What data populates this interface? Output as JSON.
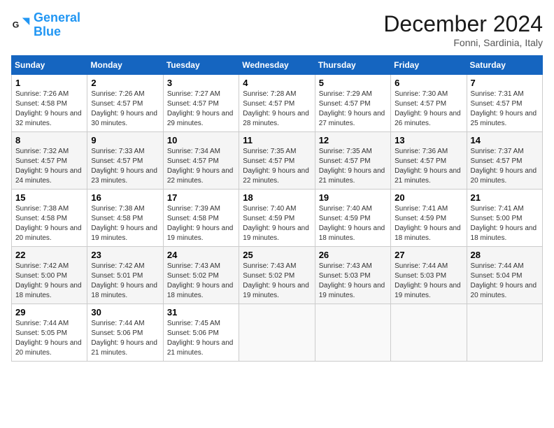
{
  "header": {
    "logo_line1": "General",
    "logo_line2": "Blue",
    "month_title": "December 2024",
    "location": "Fonni, Sardinia, Italy"
  },
  "weekdays": [
    "Sunday",
    "Monday",
    "Tuesday",
    "Wednesday",
    "Thursday",
    "Friday",
    "Saturday"
  ],
  "weeks": [
    [
      {
        "day": "1",
        "sunrise": "7:26 AM",
        "sunset": "4:58 PM",
        "daylight": "9 hours and 32 minutes."
      },
      {
        "day": "2",
        "sunrise": "7:26 AM",
        "sunset": "4:57 PM",
        "daylight": "9 hours and 30 minutes."
      },
      {
        "day": "3",
        "sunrise": "7:27 AM",
        "sunset": "4:57 PM",
        "daylight": "9 hours and 29 minutes."
      },
      {
        "day": "4",
        "sunrise": "7:28 AM",
        "sunset": "4:57 PM",
        "daylight": "9 hours and 28 minutes."
      },
      {
        "day": "5",
        "sunrise": "7:29 AM",
        "sunset": "4:57 PM",
        "daylight": "9 hours and 27 minutes."
      },
      {
        "day": "6",
        "sunrise": "7:30 AM",
        "sunset": "4:57 PM",
        "daylight": "9 hours and 26 minutes."
      },
      {
        "day": "7",
        "sunrise": "7:31 AM",
        "sunset": "4:57 PM",
        "daylight": "9 hours and 25 minutes."
      }
    ],
    [
      {
        "day": "8",
        "sunrise": "7:32 AM",
        "sunset": "4:57 PM",
        "daylight": "9 hours and 24 minutes."
      },
      {
        "day": "9",
        "sunrise": "7:33 AM",
        "sunset": "4:57 PM",
        "daylight": "9 hours and 23 minutes."
      },
      {
        "day": "10",
        "sunrise": "7:34 AM",
        "sunset": "4:57 PM",
        "daylight": "9 hours and 22 minutes."
      },
      {
        "day": "11",
        "sunrise": "7:35 AM",
        "sunset": "4:57 PM",
        "daylight": "9 hours and 22 minutes."
      },
      {
        "day": "12",
        "sunrise": "7:35 AM",
        "sunset": "4:57 PM",
        "daylight": "9 hours and 21 minutes."
      },
      {
        "day": "13",
        "sunrise": "7:36 AM",
        "sunset": "4:57 PM",
        "daylight": "9 hours and 21 minutes."
      },
      {
        "day": "14",
        "sunrise": "7:37 AM",
        "sunset": "4:57 PM",
        "daylight": "9 hours and 20 minutes."
      }
    ],
    [
      {
        "day": "15",
        "sunrise": "7:38 AM",
        "sunset": "4:58 PM",
        "daylight": "9 hours and 20 minutes."
      },
      {
        "day": "16",
        "sunrise": "7:38 AM",
        "sunset": "4:58 PM",
        "daylight": "9 hours and 19 minutes."
      },
      {
        "day": "17",
        "sunrise": "7:39 AM",
        "sunset": "4:58 PM",
        "daylight": "9 hours and 19 minutes."
      },
      {
        "day": "18",
        "sunrise": "7:40 AM",
        "sunset": "4:59 PM",
        "daylight": "9 hours and 19 minutes."
      },
      {
        "day": "19",
        "sunrise": "7:40 AM",
        "sunset": "4:59 PM",
        "daylight": "9 hours and 18 minutes."
      },
      {
        "day": "20",
        "sunrise": "7:41 AM",
        "sunset": "4:59 PM",
        "daylight": "9 hours and 18 minutes."
      },
      {
        "day": "21",
        "sunrise": "7:41 AM",
        "sunset": "5:00 PM",
        "daylight": "9 hours and 18 minutes."
      }
    ],
    [
      {
        "day": "22",
        "sunrise": "7:42 AM",
        "sunset": "5:00 PM",
        "daylight": "9 hours and 18 minutes."
      },
      {
        "day": "23",
        "sunrise": "7:42 AM",
        "sunset": "5:01 PM",
        "daylight": "9 hours and 18 minutes."
      },
      {
        "day": "24",
        "sunrise": "7:43 AM",
        "sunset": "5:02 PM",
        "daylight": "9 hours and 18 minutes."
      },
      {
        "day": "25",
        "sunrise": "7:43 AM",
        "sunset": "5:02 PM",
        "daylight": "9 hours and 19 minutes."
      },
      {
        "day": "26",
        "sunrise": "7:43 AM",
        "sunset": "5:03 PM",
        "daylight": "9 hours and 19 minutes."
      },
      {
        "day": "27",
        "sunrise": "7:44 AM",
        "sunset": "5:03 PM",
        "daylight": "9 hours and 19 minutes."
      },
      {
        "day": "28",
        "sunrise": "7:44 AM",
        "sunset": "5:04 PM",
        "daylight": "9 hours and 20 minutes."
      }
    ],
    [
      {
        "day": "29",
        "sunrise": "7:44 AM",
        "sunset": "5:05 PM",
        "daylight": "9 hours and 20 minutes."
      },
      {
        "day": "30",
        "sunrise": "7:44 AM",
        "sunset": "5:06 PM",
        "daylight": "9 hours and 21 minutes."
      },
      {
        "day": "31",
        "sunrise": "7:45 AM",
        "sunset": "5:06 PM",
        "daylight": "9 hours and 21 minutes."
      },
      null,
      null,
      null,
      null
    ]
  ]
}
